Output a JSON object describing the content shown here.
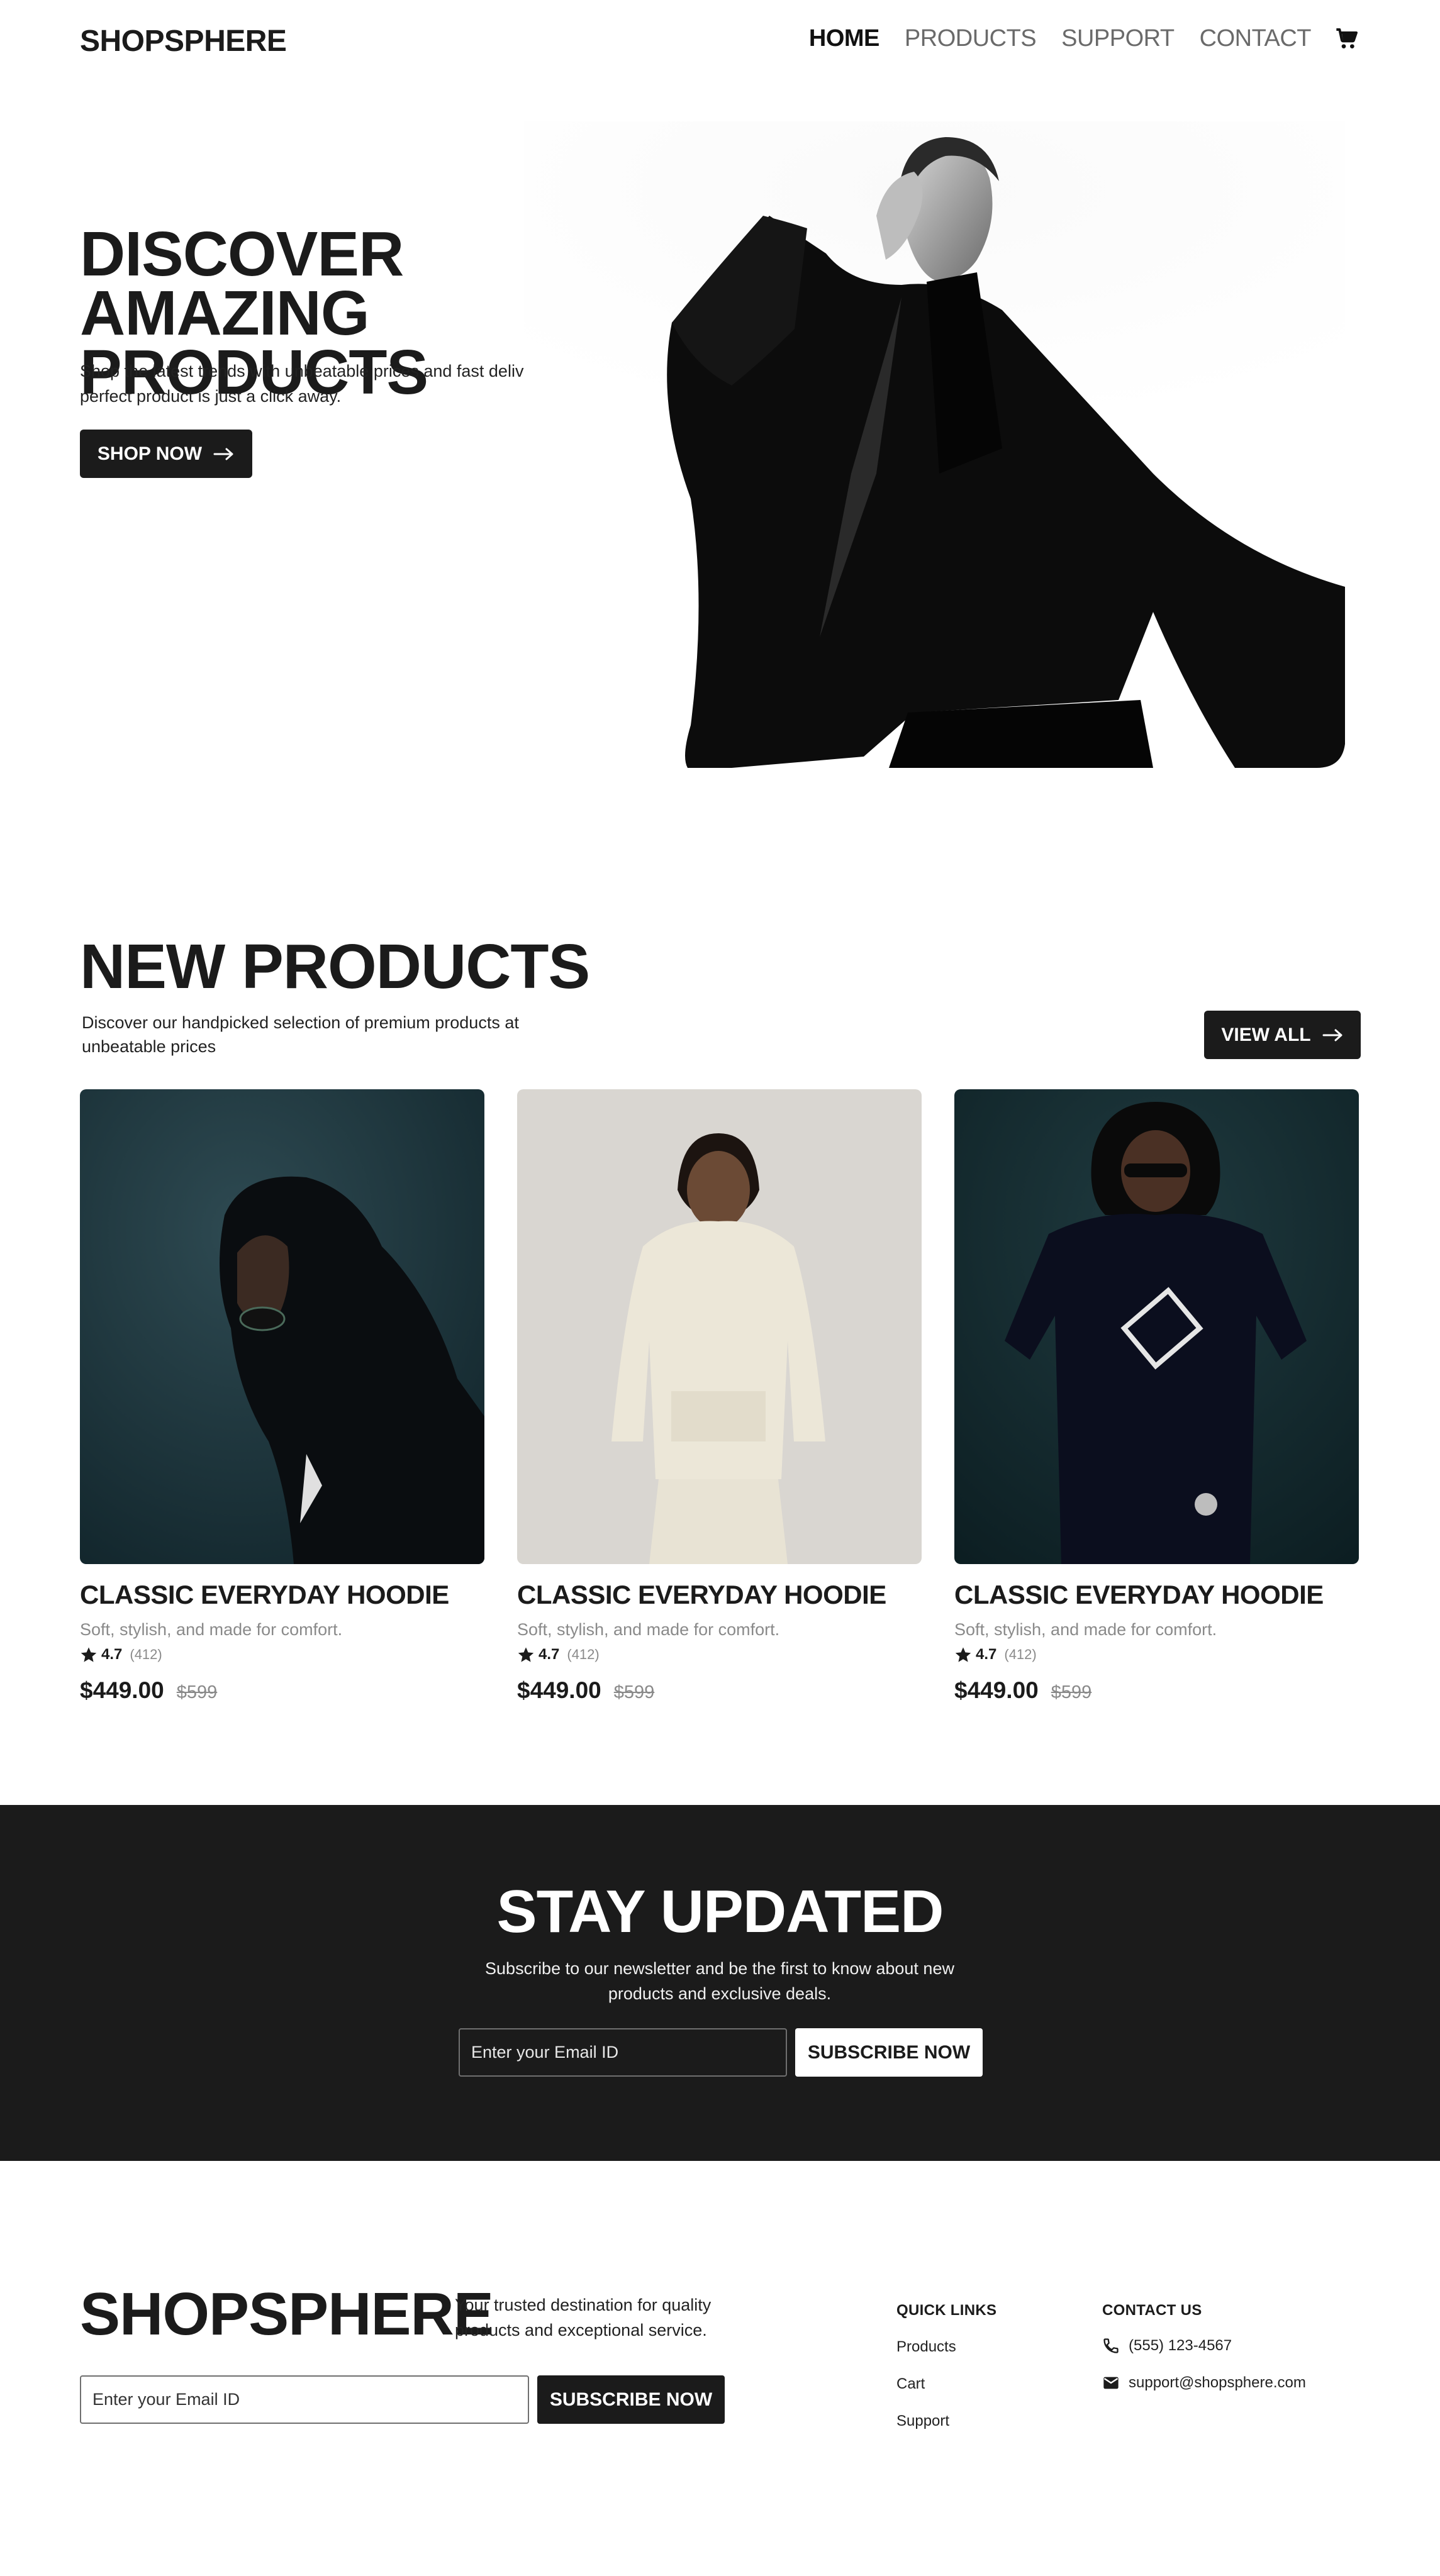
{
  "header": {
    "brand": "SHOPSPHERE",
    "nav": [
      "HOME",
      "PRODUCTS",
      "SUPPORT",
      "CONTACT"
    ],
    "active_nav": "HOME",
    "cart_icon": "cart-icon"
  },
  "hero": {
    "title": "DISCOVER AMAZING PRODUCTS",
    "subtitle": "Shop the latest trends with unbeatable prices and fast delivery. Your perfect product is just a click away.",
    "cta_label": "SHOP NOW",
    "image": "model-black-coat"
  },
  "new_products": {
    "title": "NEW PRODUCTS",
    "subtitle": "Discover our handpicked selection of premium products at unbeatable prices",
    "view_all_label": "VIEW ALL",
    "items": [
      {
        "image": "model-dark-hoodie-profile",
        "title": "CLASSIC EVERYDAY HOODIE",
        "desc": "Soft, stylish, and made for comfort.",
        "rating": "4.7",
        "reviews": "(412)",
        "price": "$449.00",
        "old_price": "$599"
      },
      {
        "image": "model-cream-hoodie",
        "title": "CLASSIC EVERYDAY HOODIE",
        "desc": "Soft, stylish, and made for comfort.",
        "rating": "4.7",
        "reviews": "(412)",
        "price": "$449.00",
        "old_price": "$599"
      },
      {
        "image": "model-black-tee-graphic",
        "title": "CLASSIC EVERYDAY HOODIE",
        "desc": "Soft, stylish, and made for comfort.",
        "rating": "4.7",
        "reviews": "(412)",
        "price": "$449.00",
        "old_price": "$599"
      }
    ]
  },
  "newsletter": {
    "title": "STAY UPDATED",
    "subtitle": "Subscribe to our newsletter and be the first to know about new products and exclusive deals.",
    "email_placeholder": "Enter your Email ID",
    "button_label": "SUBSCRIBE NOW"
  },
  "footer": {
    "brand": "SHOPSPHERE",
    "tagline": "Your trusted destination for quality products and exceptional service.",
    "email_placeholder": "Enter your Email ID",
    "button_label": "SUBSCRIBE NOW",
    "quick_links_title": "QUICK LINKS",
    "quick_links": [
      "Products",
      "Cart",
      "Support"
    ],
    "contact_title": "CONTACT US",
    "phone": "(555) 123-4567",
    "email": "support@shopsphere.com"
  },
  "colors": {
    "dark": "#1b1b1b",
    "muted": "#8a8a8a",
    "white": "#ffffff"
  }
}
